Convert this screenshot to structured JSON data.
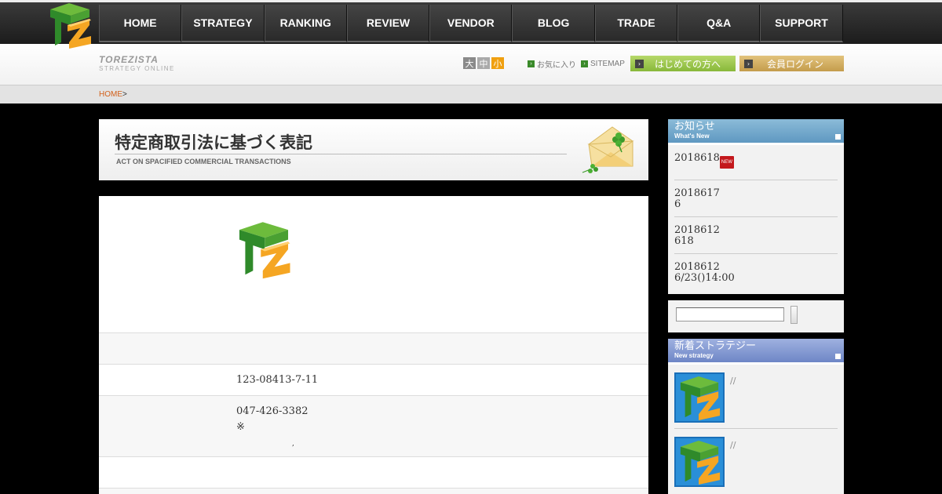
{
  "nav": {
    "items": [
      "HOME",
      "STRATEGY",
      "RANKING",
      "REVIEW",
      "VENDOR",
      "BLOG",
      "TRADE",
      "Q&A",
      "SUPPORT"
    ]
  },
  "brand": {
    "name": "TOREZISTA",
    "tagline": "STRATEGY ONLINE"
  },
  "font_size": {
    "large": "大",
    "medium": "中",
    "small": "小"
  },
  "links": {
    "favorites": "お気に入り",
    "sitemap": "SITEMAP"
  },
  "buttons": {
    "first_time": "はじめての方へ",
    "login": "会員ログイン"
  },
  "breadcrumb": {
    "home": "HOME",
    "sep": ">"
  },
  "page": {
    "title": "特定商取引法に基づく表記",
    "subtitle": "ACT ON SPACIFIED COMMERCIAL TRANSACTIONS"
  },
  "details": {
    "row2": "123-08413-7-11",
    "row3_line1": "047-426-3382",
    "row3_line2": "※",
    "row3_line3": ","
  },
  "sidebar": {
    "news_title": "お知らせ",
    "news_sub": "What's New",
    "news_badge": "NEW",
    "news": [
      {
        "date": "2018618",
        "text": ""
      },
      {
        "date": "2018617",
        "text": "6"
      },
      {
        "date": "2018612",
        "text": "618"
      },
      {
        "date": "2018612",
        "text": "6/23()14:00"
      }
    ],
    "strategy_title": "新着ストラテジー",
    "strategy_sub": "New strategy",
    "strategies": [
      {
        "text": "//"
      },
      {
        "text": "//"
      }
    ]
  },
  "colors": {
    "accent_green": "#88b83a",
    "accent_gold": "#c49c4c",
    "news_header": "#5f98c1",
    "strategy_header": "#6e86c6",
    "breadcrumb_link": "#d2601a"
  }
}
